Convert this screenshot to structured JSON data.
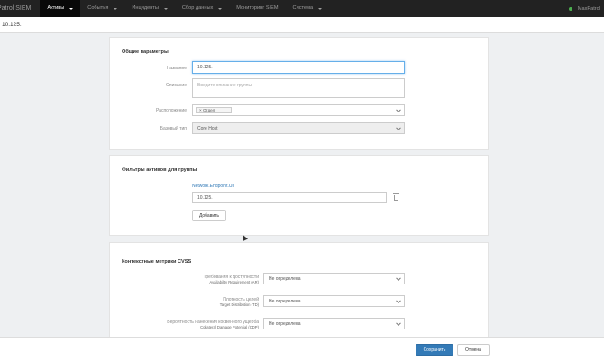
{
  "nav": {
    "brand": "Patrol SIEM",
    "items": [
      {
        "label": "Активы",
        "active": true,
        "caret": true
      },
      {
        "label": "События",
        "active": false,
        "caret": true
      },
      {
        "label": "Инциденты",
        "active": false,
        "caret": true
      },
      {
        "label": "Сбор данных",
        "active": false,
        "caret": true
      },
      {
        "label": "Мониторинг SIEM",
        "active": false,
        "caret": false
      },
      {
        "label": "Система",
        "active": false,
        "caret": true
      }
    ],
    "user": "MaxPatrol"
  },
  "breadcrumb": "10.125.",
  "general": {
    "title": "Общие параметры",
    "name_label": "Название",
    "name_value": "10.125.",
    "desc_label": "Описание",
    "desc_placeholder": "Введите описание группы",
    "location_label": "Расположение",
    "location_tag": "Отдел",
    "base_type_label": "Базовый тип",
    "base_type_value": "Core Host"
  },
  "filters": {
    "title": "Фильтры активов для группы",
    "field_link": "Network.Endpoint.Uri",
    "field_value": "10.125.",
    "add_button": "Добавить"
  },
  "cvss": {
    "title": "Контекстные метрики CVSS",
    "rows": [
      {
        "label": "Требования к доступности",
        "sublabel": "Availability Requirement (AR)",
        "value": "Не определена"
      },
      {
        "label": "Плотность целей",
        "sublabel": "Target Distribution (TD)",
        "value": "Не определена"
      },
      {
        "label": "Вероятность нанесения косвенного ущерба",
        "sublabel": "Collateral Damage Potential (CDP)",
        "value": "Не определена"
      }
    ]
  },
  "footer": {
    "save": "Сохранить",
    "cancel": "Отмена"
  }
}
